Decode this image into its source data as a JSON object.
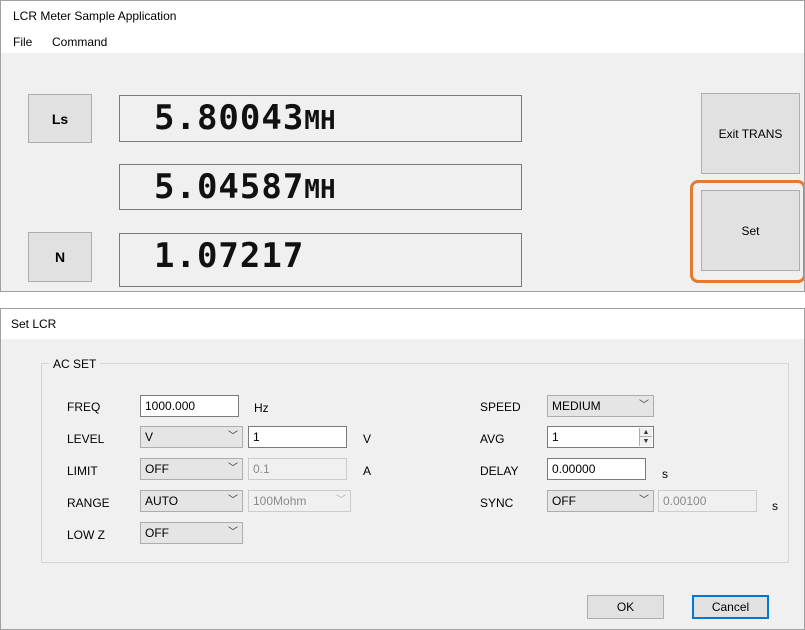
{
  "main_window": {
    "title": "LCR Meter Sample Application",
    "menu": [
      "File",
      "Command"
    ],
    "param1": "Ls",
    "param2": "N",
    "display1": {
      "value": "5.80043",
      "unit": "MH"
    },
    "display2": {
      "value": "5.04587",
      "unit": "MH"
    },
    "display3": {
      "value": "1.07217",
      "unit": ""
    },
    "exit_trans_label": "Exit TRANS",
    "set_label": "Set",
    "highlight_color": "#e27a2f"
  },
  "dialog": {
    "title": "Set LCR",
    "group_title": "AC SET",
    "freq": {
      "label": "FREQ",
      "value": "1000.000",
      "unit": "Hz"
    },
    "level": {
      "label": "LEVEL",
      "mode": "V",
      "value": "1",
      "unit": "V"
    },
    "limit": {
      "label": "LIMIT",
      "mode": "OFF",
      "value": "0.1",
      "unit": "A"
    },
    "range": {
      "label": "RANGE",
      "mode": "AUTO",
      "value": "100Mohm"
    },
    "lowz": {
      "label": "LOW Z",
      "mode": "OFF"
    },
    "speed": {
      "label": "SPEED",
      "value": "MEDIUM"
    },
    "avg": {
      "label": "AVG",
      "value": "1"
    },
    "delay": {
      "label": "DELAY",
      "value": "0.00000",
      "unit": "s"
    },
    "sync": {
      "label": "SYNC",
      "mode": "OFF",
      "value": "0.00100",
      "unit": "s"
    },
    "ok_label": "OK",
    "cancel_label": "Cancel"
  }
}
